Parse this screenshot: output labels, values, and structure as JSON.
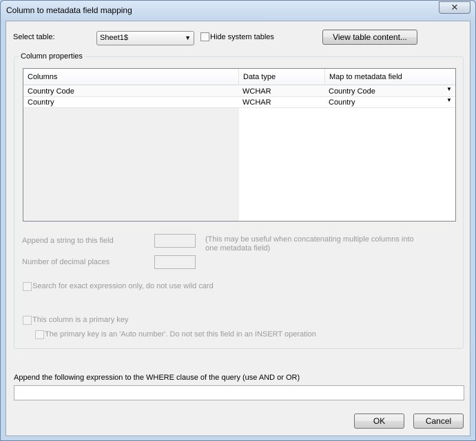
{
  "window": {
    "title": "Column to metadata field mapping",
    "close_glyph": "✕"
  },
  "top": {
    "select_table_label": "Select table:",
    "table_value": "Sheet1$",
    "hide_system_tables_label": "Hide system tables",
    "view_table_button": "View table content..."
  },
  "column_properties": {
    "legend": "Column properties",
    "headers": [
      "Columns",
      "Data type",
      "Map to metadata field"
    ],
    "rows": [
      {
        "column": "Country Code",
        "data_type": "WCHAR",
        "mapped_field": "Country Code"
      },
      {
        "column": "Country",
        "data_type": "WCHAR",
        "mapped_field": "Country"
      }
    ],
    "append_string_label": "Append a string to this field",
    "append_hint": "(This may be useful when concatenating multiple columns into one metadata field)",
    "decimal_places_label": "Number of decimal places",
    "exact_expression_label": "Search for exact expression only, do not use wild card",
    "primary_key_label": "This column is a primary key",
    "auto_number_label": "The primary key is an 'Auto number'. Do not set this field in an INSERT operation"
  },
  "where_clause": {
    "label": "Append the following expression to the WHERE clause of the query (use AND or OR)",
    "value": ""
  },
  "footer": {
    "ok_button": "OK",
    "cancel_button": "Cancel"
  },
  "icons": {
    "dropdown": "chevron-down-icon",
    "close": "close-icon"
  }
}
